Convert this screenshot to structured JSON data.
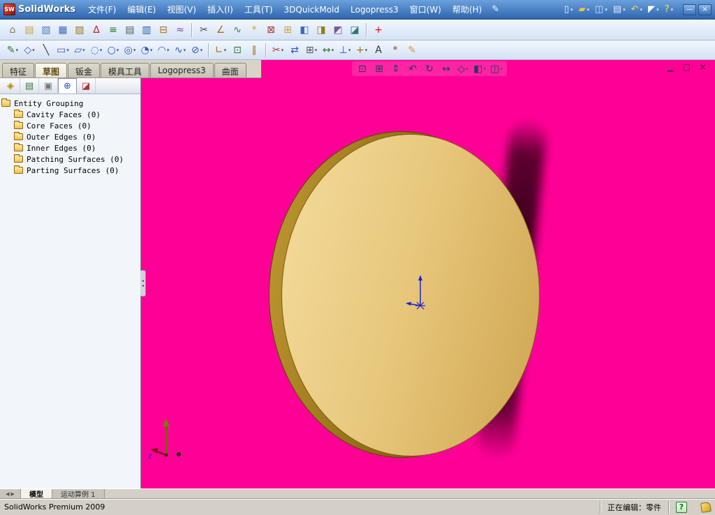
{
  "colors": {
    "viewport_bg": "#ff0096",
    "disc_face": "#e7c77c",
    "disc_face_light": "#f2d897",
    "disc_face_dark": "#d3ab58",
    "disc_rim": "#8a660e",
    "disc_rim_light": "#c09a34",
    "titlebar_from": "#6aa0dc",
    "titlebar_to": "#2f66ae",
    "shadow_streak": "#28000e"
  },
  "titlebar": {
    "app_name": "SolidWorks",
    "logo_mark": "SW",
    "menus": [
      {
        "name": "menu-file",
        "label": "文件(F)"
      },
      {
        "name": "menu-edit",
        "label": "编辑(E)"
      },
      {
        "name": "menu-view",
        "label": "视图(V)"
      },
      {
        "name": "menu-insert",
        "label": "插入(I)"
      },
      {
        "name": "menu-tools",
        "label": "工具(T)"
      },
      {
        "name": "menu-3dquickmold",
        "label": "3DQuickMold"
      },
      {
        "name": "menu-logopress3",
        "label": "Logopress3"
      },
      {
        "name": "menu-window",
        "label": "窗口(W)"
      },
      {
        "name": "menu-help",
        "label": "帮助(H)"
      }
    ],
    "quick_icons": [
      {
        "name": "new-document-icon",
        "glyph": "▯",
        "color": "#f5f8ff",
        "caret": true
      },
      {
        "name": "open-icon",
        "glyph": "▰",
        "color": "#f0c040",
        "caret": true
      },
      {
        "name": "save-icon",
        "glyph": "◫",
        "color": "#cfe2ff",
        "caret": true
      },
      {
        "name": "print-icon",
        "glyph": "▤",
        "color": "#dde8f8",
        "caret": true
      },
      {
        "name": "undo-icon",
        "glyph": "↶",
        "color": "#ffd24a",
        "caret": true
      },
      {
        "name": "select-icon",
        "glyph": "◤",
        "color": "#ffffff",
        "caret": true
      },
      {
        "name": "help-icon",
        "glyph": "?",
        "color": "#ffe24a",
        "caret": true
      }
    ],
    "window_buttons": [
      {
        "name": "minimize-button",
        "glyph": "—"
      },
      {
        "name": "close-button",
        "glyph": "×"
      }
    ]
  },
  "toolbar_mold": {
    "icons": [
      {
        "name": "mold-doctor-icon",
        "glyph": "⌂",
        "color": "#8a7a5a"
      },
      {
        "name": "insert-folder-icon",
        "glyph": "▤",
        "color": "#caa23a"
      },
      {
        "name": "surface-bodies-icon",
        "glyph": "▧",
        "color": "#4a7ebb"
      },
      {
        "name": "planar-surface-icon",
        "glyph": "▦",
        "color": "#3a6ab0"
      },
      {
        "name": "offset-surface-icon",
        "glyph": "▨",
        "color": "#9a7a20"
      },
      {
        "name": "scale-icon",
        "glyph": "∆",
        "color": "#cc2222"
      },
      {
        "name": "move-face-icon",
        "glyph": "≡",
        "color": "#2a7a2a"
      },
      {
        "name": "feature-list-icon",
        "glyph": "▤",
        "color": "#555555"
      },
      {
        "name": "draft-analysis-icon",
        "glyph": "▥",
        "color": "#2a5aaa"
      },
      {
        "name": "undercut-detection-icon",
        "glyph": "⊟",
        "color": "#aa6a22"
      },
      {
        "name": "parting-line-icon",
        "glyph": "≈",
        "color": "#8a44aa"
      },
      {
        "sep": true
      },
      {
        "name": "split-line-icon",
        "glyph": "✂",
        "color": "#444444"
      },
      {
        "name": "draft-icon",
        "glyph": "∠",
        "color": "#b06a10"
      },
      {
        "name": "ruled-surface-icon",
        "glyph": "∿",
        "color": "#3a7a3a"
      },
      {
        "name": "radiate-surface-icon",
        "glyph": "*",
        "color": "#caa23a"
      },
      {
        "name": "shut-off-surface-icon",
        "glyph": "⊠",
        "color": "#aa3333"
      },
      {
        "name": "parting-surface-icon",
        "glyph": "⊞",
        "color": "#caa23a"
      },
      {
        "name": "tooling-split-icon",
        "glyph": "◧",
        "color": "#3a6ab0"
      },
      {
        "name": "core-icon",
        "glyph": "◨",
        "color": "#9a7a20"
      },
      {
        "name": "cavity-icon",
        "glyph": "◩",
        "color": "#7a5a9a"
      },
      {
        "name": "insert-mold-base-icon",
        "glyph": "◪",
        "color": "#2a7a7a"
      },
      {
        "sep": true
      },
      {
        "name": "add-tool-icon",
        "glyph": "+",
        "color": "#dd1111"
      }
    ]
  },
  "toolbar_sketch": {
    "icons": [
      {
        "name": "sketch-icon",
        "glyph": "✎",
        "color": "#2a7a2a",
        "caret": true
      },
      {
        "name": "smart-dimension-icon",
        "glyph": "◇",
        "color": "#3355bb",
        "caret": true
      },
      {
        "name": "line-icon",
        "glyph": "╲",
        "color": "#333333"
      },
      {
        "name": "rectangle-icon",
        "glyph": "▭",
        "color": "#3355bb",
        "caret": true
      },
      {
        "name": "parallelogram-icon",
        "glyph": "▱",
        "color": "#3355bb",
        "caret": true
      },
      {
        "name": "slot-icon",
        "glyph": "◌",
        "color": "#3355bb",
        "caret": true
      },
      {
        "name": "circle-icon",
        "glyph": "○",
        "color": "#3355bb",
        "caret": true
      },
      {
        "name": "perimeter-circle-icon",
        "glyph": "◎",
        "color": "#3355bb",
        "caret": true
      },
      {
        "name": "centerpoint-arc-icon",
        "glyph": "◔",
        "color": "#3355bb",
        "caret": true
      },
      {
        "name": "tangent-arc-icon",
        "glyph": "◠",
        "color": "#3355bb",
        "caret": true
      },
      {
        "name": "spline-icon",
        "glyph": "∿",
        "color": "#3355bb",
        "caret": true
      },
      {
        "name": "ellipse-icon",
        "glyph": "⊘",
        "color": "#3355bb",
        "caret": true
      },
      {
        "sep": true
      },
      {
        "name": "sketch-fillet-icon",
        "glyph": "∟",
        "color": "#b06a10",
        "caret": true
      },
      {
        "name": "convert-entities-icon",
        "glyph": "⊡",
        "color": "#2a7a2a"
      },
      {
        "name": "offset-entities-icon",
        "glyph": "∥",
        "color": "#b06a10"
      },
      {
        "sep": true
      },
      {
        "name": "trim-entities-icon",
        "glyph": "✂",
        "color": "#aa3333",
        "caret": true
      },
      {
        "name": "mirror-entities-icon",
        "glyph": "⇄",
        "color": "#3355bb"
      },
      {
        "name": "linear-pattern-icon",
        "glyph": "⊞",
        "color": "#555555",
        "caret": true
      },
      {
        "name": "move-entities-icon",
        "glyph": "↔",
        "color": "#2a7a2a",
        "caret": true
      },
      {
        "name": "display-relations-icon",
        "glyph": "⊥",
        "color": "#3355bb",
        "caret": true
      },
      {
        "name": "quick-snaps-icon",
        "glyph": "+",
        "color": "#b06a10",
        "caret": true
      },
      {
        "name": "text-icon",
        "glyph": "A",
        "color": "#333333"
      },
      {
        "name": "point-icon",
        "glyph": "*",
        "color": "#aa3333"
      },
      {
        "name": "sketch-picture-icon",
        "glyph": "✎",
        "color": "#caa23a"
      }
    ]
  },
  "command_manager": {
    "tabs": [
      {
        "name": "tab-features",
        "label": "特征"
      },
      {
        "name": "tab-sketch",
        "label": "草图",
        "active": true
      },
      {
        "name": "tab-sheet-metal",
        "label": "钣金"
      },
      {
        "name": "tab-mold-tools",
        "label": "模具工具"
      },
      {
        "name": "tab-logopress3",
        "label": "Logopress3"
      },
      {
        "name": "tab-surfaces",
        "label": "曲面"
      }
    ]
  },
  "view_toolbar": {
    "icons": [
      {
        "name": "zoom-fit-icon",
        "glyph": "⊡",
        "color": "#223a5e"
      },
      {
        "name": "zoom-area-icon",
        "glyph": "⊞",
        "color": "#223a5e"
      },
      {
        "name": "zoom-in-out-icon",
        "glyph": "⇕",
        "color": "#223a5e"
      },
      {
        "name": "previous-view-icon",
        "glyph": "↶",
        "color": "#223a5e"
      },
      {
        "name": "rotate-view-icon",
        "glyph": "↻",
        "color": "#223a5e"
      },
      {
        "name": "pan-icon",
        "glyph": "↔",
        "color": "#223a5e"
      },
      {
        "name": "standard-views-icon",
        "glyph": "◇",
        "color": "#223a5e",
        "caret": true
      },
      {
        "name": "display-style-icon",
        "glyph": "◧",
        "color": "#223a5e",
        "caret": true
      },
      {
        "name": "view-orientation-icon",
        "glyph": "◫",
        "color": "#223a5e",
        "caret": true
      }
    ]
  },
  "viewport_buttons": [
    {
      "name": "viewport-minimize-button",
      "glyph": "▁"
    },
    {
      "name": "viewport-restore-button",
      "glyph": "▢"
    },
    {
      "name": "viewport-close-button",
      "glyph": "×"
    }
  ],
  "feature_panel": {
    "tabs": [
      {
        "name": "feature-manager-tab",
        "glyph": "◈",
        "color": "#b8860b"
      },
      {
        "name": "property-manager-tab",
        "glyph": "▤",
        "color": "#3a7a3a"
      },
      {
        "name": "configuration-manager-tab",
        "glyph": "▣",
        "color": "#777777"
      },
      {
        "name": "dimxpert-manager-tab",
        "glyph": "⊕",
        "color": "#2255cc",
        "active": true
      },
      {
        "name": "display-manager-tab",
        "glyph": "◪",
        "color": "#aa3333"
      }
    ],
    "tree": {
      "root": "Entity Grouping",
      "items": [
        {
          "label": "Cavity Faces (0)"
        },
        {
          "label": "Core Faces (0)"
        },
        {
          "label": "Outer Edges (0)"
        },
        {
          "label": "Inner Edges (0)"
        },
        {
          "label": "Patching Surfaces (0)"
        },
        {
          "label": "Parting Surfaces (0)"
        }
      ]
    }
  },
  "bottom_bar": {
    "tabs": [
      {
        "name": "model-tab",
        "label": "模型",
        "active": true
      },
      {
        "name": "motion-study-tab",
        "label": "运动算例 1"
      }
    ]
  },
  "statusbar": {
    "left": "SolidWorks Premium 2009",
    "editing": "正在编辑：零件",
    "help_badge": "?"
  }
}
